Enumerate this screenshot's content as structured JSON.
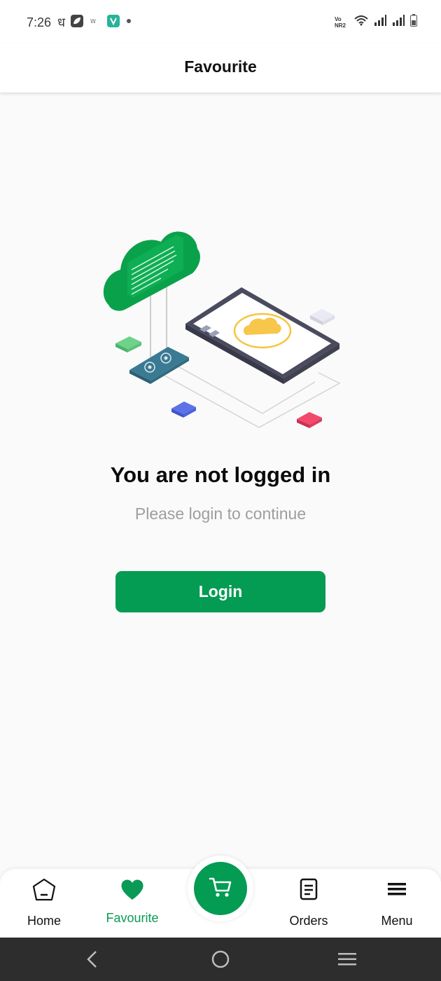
{
  "status_bar": {
    "time": "7:26",
    "left_glyph": "ध",
    "left_icons": [
      "notification-leaf-icon",
      "notification-app-icon",
      "notification-v-icon",
      "dot-icon"
    ],
    "right_icons": [
      "volte-icon",
      "wifi-icon",
      "signal-1-icon",
      "signal-2-icon",
      "battery-icon"
    ],
    "volte_text": "Vo NR2"
  },
  "header": {
    "title": "Favourite"
  },
  "empty_state": {
    "title": "You are not logged in",
    "subtitle": "Please login to continue",
    "button_label": "Login"
  },
  "bottom_nav": {
    "items": [
      {
        "label": "Home",
        "icon": "home-icon",
        "active": false
      },
      {
        "label": "Favourite",
        "icon": "heart-icon",
        "active": true
      },
      {
        "label": "Orders",
        "icon": "orders-icon",
        "active": false
      },
      {
        "label": "Menu",
        "icon": "menu-icon",
        "active": false
      }
    ],
    "center_icon": "cart-icon"
  },
  "system_nav": {
    "icons": [
      "back-icon",
      "home-circle-icon",
      "recents-icon"
    ]
  },
  "colors": {
    "accent": "#049b53",
    "accent_text": "#0a9a55",
    "background": "#fafafa",
    "system_nav": "#2d2d2d"
  }
}
